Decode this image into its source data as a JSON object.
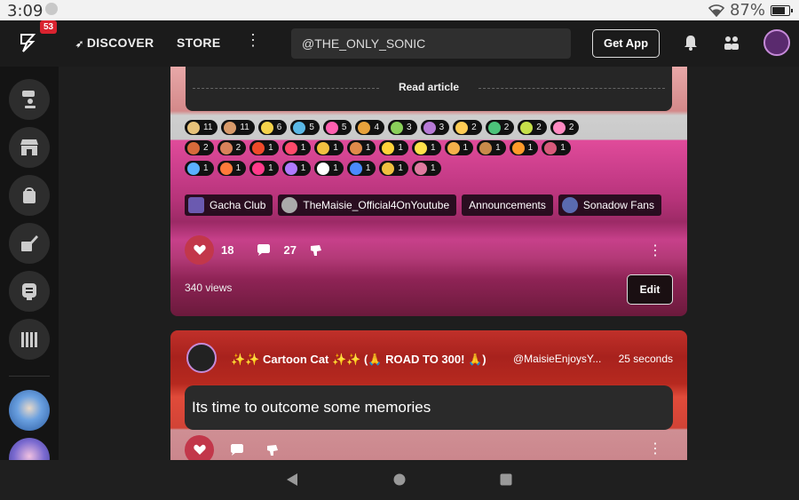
{
  "status_bar": {
    "time": "3:09",
    "battery": "87%"
  },
  "top_nav": {
    "badge_count": "53",
    "discover_label": "DISCOVER",
    "store_label": "STORE",
    "more_label": "⋮",
    "search_value": "@THE_ONLY_SONIC",
    "get_app_label": "Get App"
  },
  "sidebar": {
    "items": [
      {
        "name": "leaderboard-icon"
      },
      {
        "name": "store-icon"
      },
      {
        "name": "bag-icon"
      },
      {
        "name": "compose-icon"
      },
      {
        "name": "chat-icon"
      },
      {
        "name": "library-icon"
      }
    ]
  },
  "card1": {
    "read_article_label": "Read article",
    "reactions": [
      {
        "count": "11",
        "color": "#e7c27a"
      },
      {
        "count": "11",
        "color": "#d89a6a"
      },
      {
        "count": "6",
        "color": "#f5d34b"
      },
      {
        "count": "5",
        "color": "#5ab8e6"
      },
      {
        "count": "5",
        "color": "#ff5fb0"
      },
      {
        "count": "4",
        "color": "#e8a23c"
      },
      {
        "count": "3",
        "color": "#8ad05a"
      },
      {
        "count": "3",
        "color": "#b77ad6"
      },
      {
        "count": "2",
        "color": "#ffcc55"
      },
      {
        "count": "2",
        "color": "#4cc37a"
      },
      {
        "count": "2",
        "color": "#c6e04a"
      },
      {
        "count": "2",
        "color": "#ff8ac2"
      },
      {
        "count": "2",
        "color": "#d66a3a"
      },
      {
        "count": "2",
        "color": "#d9825a"
      },
      {
        "count": "1",
        "color": "#f04a2a"
      },
      {
        "count": "1",
        "color": "#ff4a6a"
      },
      {
        "count": "1",
        "color": "#f1c040"
      },
      {
        "count": "1",
        "color": "#e08a4a"
      },
      {
        "count": "1",
        "color": "#ffd23a"
      },
      {
        "count": "1",
        "color": "#ffe14a"
      },
      {
        "count": "1",
        "color": "#f4b04a"
      },
      {
        "count": "1",
        "color": "#c88a4a"
      },
      {
        "count": "1",
        "color": "#ff9a2a"
      },
      {
        "count": "1",
        "color": "#d85a7a"
      },
      {
        "count": "1",
        "color": "#5ab0ff"
      },
      {
        "count": "1",
        "color": "#ff7a3a"
      },
      {
        "count": "1",
        "color": "#ff3a8a"
      },
      {
        "count": "1",
        "color": "#b07aff"
      },
      {
        "count": "1",
        "color": "#ffffff"
      },
      {
        "count": "1",
        "color": "#4a8aff"
      },
      {
        "count": "1",
        "color": "#f0c040"
      },
      {
        "count": "1",
        "color": "#e07aa0"
      }
    ],
    "tags": [
      {
        "label": "Gacha Club",
        "color": "#6b5ab0"
      },
      {
        "label": "TheMaisie_Official4OnYoutube",
        "color": "#aaaaaa"
      },
      {
        "label": "Announcements",
        "color": ""
      },
      {
        "label": "Sonadow Fans",
        "color": "#5a6ab0"
      }
    ],
    "like_count": "18",
    "comment_count": "27",
    "views": "340 views",
    "edit_label": "Edit"
  },
  "card2": {
    "author": "✨✨ Cartoon Cat ✨✨ (🙏 ROAD TO 300! 🙏)",
    "handle": "@MaisieEnjoysY...",
    "time": "25 seconds",
    "post_text": "Its time to outcome some memories"
  },
  "colors": {
    "like": "#c2374a",
    "brand_badge": "#d9232f"
  }
}
